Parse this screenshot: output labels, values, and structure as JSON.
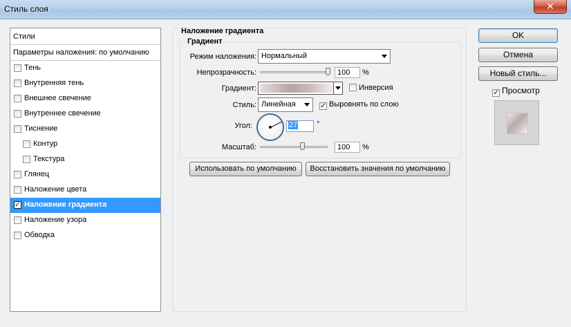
{
  "window": {
    "title": "Стиль слоя",
    "close_glyph": "✕"
  },
  "styles_panel": {
    "header": "Стили",
    "defaults": "Параметры наложения: по умолчанию",
    "items": [
      {
        "label": "Тень",
        "checked": ""
      },
      {
        "label": "Внутренняя тень",
        "checked": ""
      },
      {
        "label": "Внешнее свечение",
        "checked": ""
      },
      {
        "label": "Внутреннее свечение",
        "checked": ""
      },
      {
        "label": "Тиснение",
        "checked": ""
      },
      {
        "label": "Контур",
        "checked": ""
      },
      {
        "label": "Текстура",
        "checked": ""
      },
      {
        "label": "Глянец",
        "checked": ""
      },
      {
        "label": "Наложение цвета",
        "checked": ""
      },
      {
        "label": "Наложение градиента",
        "checked": "✓"
      },
      {
        "label": "Наложение узора",
        "checked": ""
      },
      {
        "label": "Обводка",
        "checked": ""
      }
    ]
  },
  "gradient_overlay": {
    "section_title": "Наложение градиента",
    "group_title": "Градиент",
    "blend_mode": {
      "label": "Режим наложения:",
      "value": "Нормальный"
    },
    "opacity": {
      "label": "Непрозрачность:",
      "value": "100",
      "unit": "%"
    },
    "gradient": {
      "label": "Градиент:",
      "reverse_label": "Инверсия",
      "reverse_checked": ""
    },
    "style": {
      "label": "Стиль:",
      "value": "Линейная",
      "align_label": "Выровнять по слою",
      "align_checked": "✓"
    },
    "angle": {
      "label": "Угол:",
      "value": "27",
      "unit": "°"
    },
    "scale": {
      "label": "Масштаб:",
      "value": "100",
      "unit": "%"
    },
    "make_default": "Использовать по умолчанию",
    "reset_default": "Восстановить значения по умолчанию"
  },
  "buttons": {
    "ok": "OK",
    "cancel": "Отмена",
    "new_style": "Новый стиль...",
    "preview_label": "Просмотр",
    "preview_checked": "✓"
  }
}
